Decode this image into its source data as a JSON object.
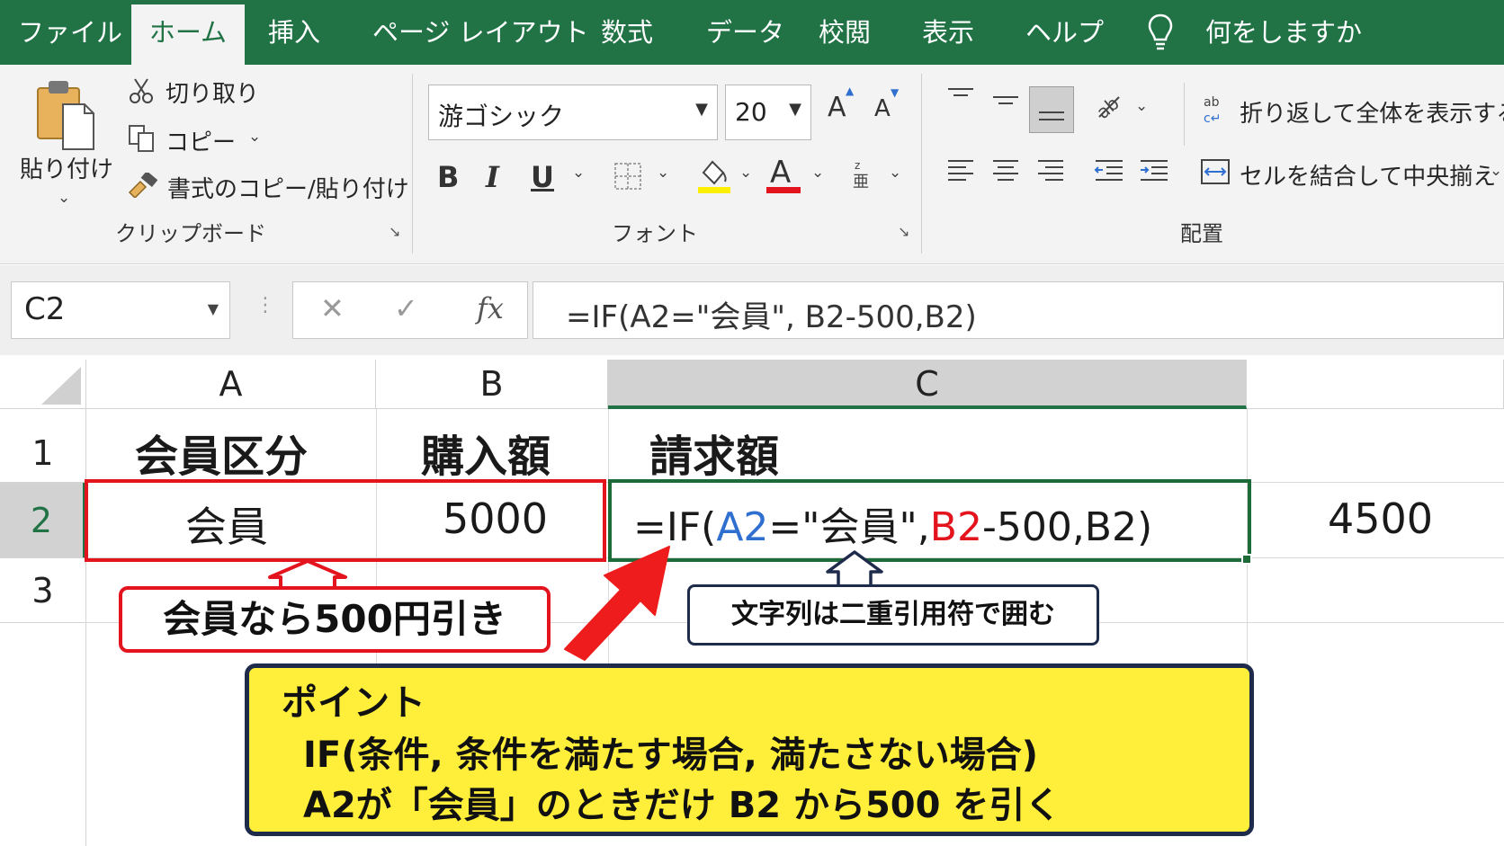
{
  "menu": {
    "tabs": [
      "ファイル",
      "ホーム",
      "挿入",
      "ページ レイアウト",
      "数式",
      "データ",
      "校閲",
      "表示",
      "ヘルプ"
    ],
    "active_tab": "ホーム",
    "search": "何をしますか"
  },
  "ribbon": {
    "clipboard": {
      "paste": "貼り付け",
      "cut": "切り取り",
      "copy": "コピー",
      "format_painter": "書式のコピー/貼り付け",
      "label": "クリップボード"
    },
    "font": {
      "family": "游ゴシック",
      "size": "20",
      "grow": "A",
      "shrink": "A",
      "bold": "B",
      "italic": "I",
      "underline": "U",
      "font_color_letter": "A",
      "label": "フォント"
    },
    "alignment": {
      "wrap_text": "折り返して全体を表示する",
      "merge_center": "セルを結合して中央揃え",
      "label": "配置"
    },
    "colors": {
      "highlight": "#ffef00",
      "font_color": "#e3141d",
      "accent": "#217346"
    }
  },
  "formula_bar": {
    "name_box": "C2",
    "fx": "fx",
    "formula": "=IF(A2=\"会員\", B2-500,B2)"
  },
  "sheet": {
    "columns": [
      "A",
      "B",
      "C"
    ],
    "rows": [
      "1",
      "2",
      "3"
    ],
    "headers": {
      "a1": "会員区分",
      "b1": "購入額",
      "c1": "請求額"
    },
    "row2": {
      "a2": "会員",
      "b2": "5000",
      "c2_parts": [
        "=IF(",
        "A2",
        "=\"会員\",",
        "B2",
        "-500,B2)"
      ],
      "d2": "4500"
    },
    "ref_colors": {
      "a2": "#2f6fd0",
      "b2": "#e3141d"
    }
  },
  "annotations": {
    "red_note": "会員なら500円引き",
    "quote_note": "文字列は二重引用符で囲む",
    "point_title": "ポイント",
    "point_line1": "IF(条件, 条件を満たす場合, 満たさない場合)",
    "point_line2": "A2が「会員」のときだけ B2 から500 を引く"
  }
}
